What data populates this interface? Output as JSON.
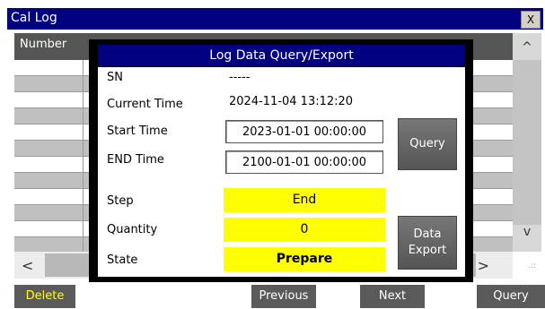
{
  "window": {
    "title": "Cal Log",
    "close_label": "X"
  },
  "table": {
    "columns": [
      "Number"
    ]
  },
  "scroll": {
    "up": "^",
    "down": "v",
    "left": "<",
    "right": ">",
    "grip": ".::"
  },
  "toolbar": {
    "delete_label": "Delete",
    "previous_label": "Previous",
    "next_label": "Next",
    "query_label": "Query"
  },
  "dialog": {
    "title": "Log Data Query/Export",
    "sn": {
      "label": "SN",
      "value": "-----"
    },
    "current_time": {
      "label": "Current Time",
      "value": "2024-11-04 13:12:20"
    },
    "start_time": {
      "label": "Start Time",
      "value": "2023-01-01 00:00:00"
    },
    "end_time": {
      "label": "END Time",
      "value": "2100-01-01 00:00:00"
    },
    "step": {
      "label": "Step",
      "value": "End"
    },
    "quantity": {
      "label": "Quantity",
      "value": "0"
    },
    "state": {
      "label": "State",
      "value": "Prepare"
    },
    "query_label": "Query",
    "export_label_line1": "Data",
    "export_label_line2": "Export"
  },
  "colors": {
    "title_bar": "#000080",
    "highlight": "#ffff00",
    "button": "#5a5a5a",
    "delete_text": "#ffff00"
  }
}
